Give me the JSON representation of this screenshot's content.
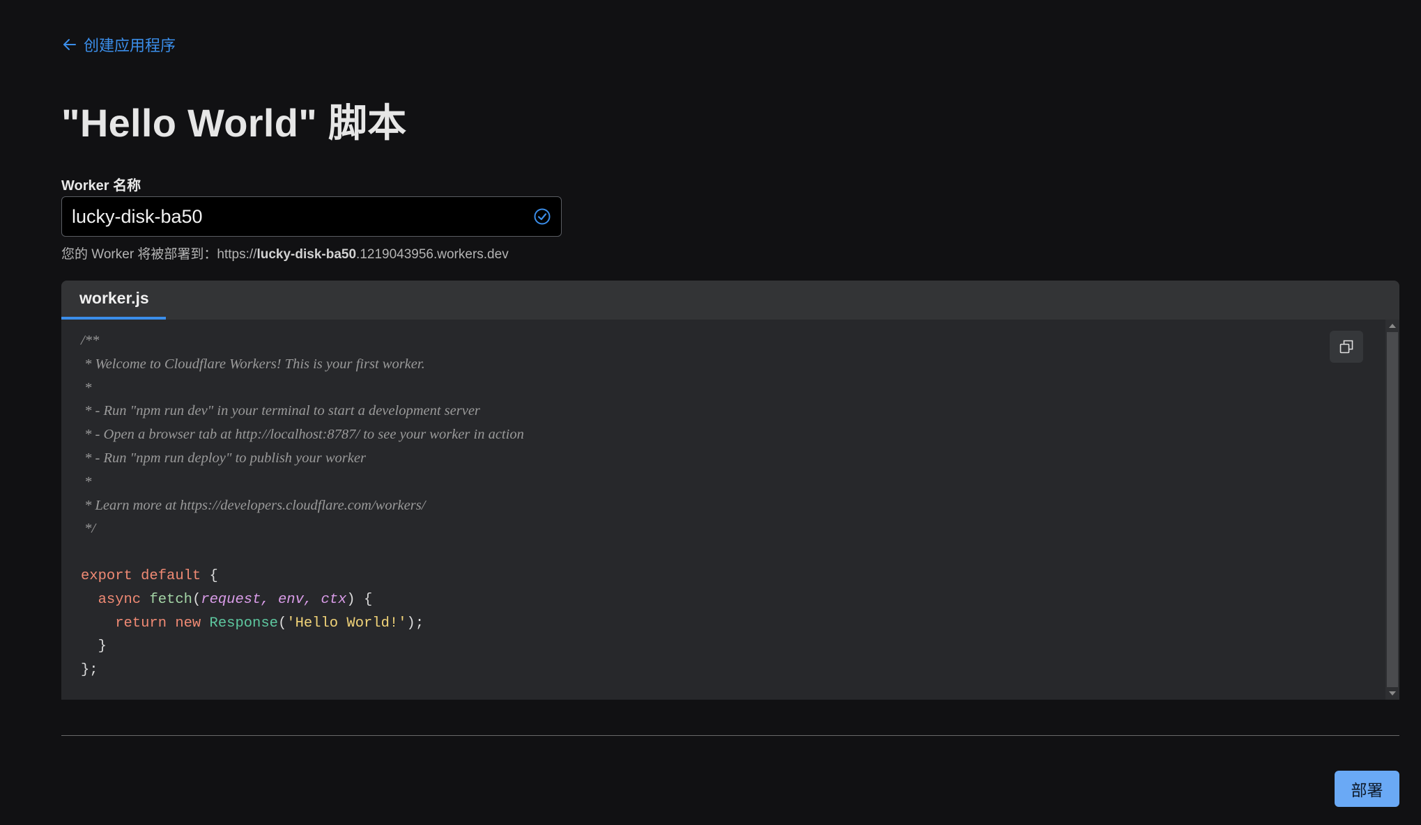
{
  "nav": {
    "back_label": "创建应用程序"
  },
  "page": {
    "title": "\"Hello World\" 脚本"
  },
  "form": {
    "name_label": "Worker 名称",
    "name_value": "lucky-disk-ba50",
    "hint_prefix": "您的 Worker 将被部署到：https://",
    "hint_name": "lucky-disk-ba50",
    "hint_suffix": ".1219043956.workers.dev"
  },
  "editor": {
    "tab_label": "worker.js",
    "code_lines": [
      [
        {
          "t": "/**",
          "c": "comment"
        }
      ],
      [
        {
          "t": " * Welcome to Cloudflare Workers! This is your first worker.",
          "c": "comment"
        }
      ],
      [
        {
          "t": " *",
          "c": "comment"
        }
      ],
      [
        {
          "t": " * - Run \"npm run dev\" in your terminal to start a development server",
          "c": "comment"
        }
      ],
      [
        {
          "t": " * - Open a browser tab at http://localhost:8787/ to see your worker in action",
          "c": "comment"
        }
      ],
      [
        {
          "t": " * - Run \"npm run deploy\" to publish your worker",
          "c": "comment"
        }
      ],
      [
        {
          "t": " *",
          "c": "comment"
        }
      ],
      [
        {
          "t": " * Learn more at https://developers.cloudflare.com/workers/",
          "c": "comment"
        }
      ],
      [
        {
          "t": " */",
          "c": "comment"
        }
      ],
      [],
      [
        {
          "t": "export default",
          "c": "kw"
        },
        {
          "t": " {",
          "c": "punc"
        }
      ],
      [
        {
          "t": "  async",
          "c": "kw"
        },
        {
          "t": " ",
          "c": "punc"
        },
        {
          "t": "fetch",
          "c": "fn"
        },
        {
          "t": "(",
          "c": "punc"
        },
        {
          "t": "request, env, ctx",
          "c": "param"
        },
        {
          "t": ") {",
          "c": "punc"
        }
      ],
      [
        {
          "t": "    return new",
          "c": "kw"
        },
        {
          "t": " ",
          "c": "punc"
        },
        {
          "t": "Response",
          "c": "cls"
        },
        {
          "t": "(",
          "c": "punc"
        },
        {
          "t": "'Hello World!'",
          "c": "str"
        },
        {
          "t": ");",
          "c": "punc"
        }
      ],
      [
        {
          "t": "  }",
          "c": "punc"
        }
      ],
      [
        {
          "t": "};",
          "c": "punc"
        }
      ]
    ]
  },
  "footer": {
    "deploy_label": "部署"
  },
  "colors": {
    "accent": "#3b8eea",
    "deploy_button": "#6aa9f5",
    "background": "#111113"
  }
}
